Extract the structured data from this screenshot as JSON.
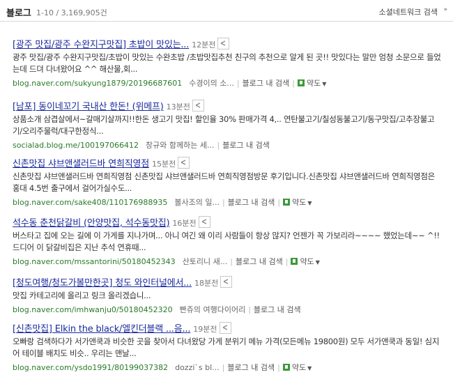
{
  "header": {
    "section_title": "블로그",
    "result_count": "1-10 / 3,169,905건",
    "social_search_label": "소셜네트워크 검색",
    "social_arrow": "»"
  },
  "icons": {
    "share": "share-icon",
    "map": "map-icon",
    "caret": "chevron-down-icon"
  },
  "common": {
    "blog_search_label": "블로그 내 검색",
    "map_label": "약도",
    "sep": "|"
  },
  "results": [
    {
      "title": "[광주 맛집/광주 수완지구맛집] 초밥이 맛있는...",
      "time": "12분전",
      "desc": "광주 맛집/광주 수완지구맛집/초밥이 맛있는 수완초밥 /초밥맛집추천 친구의 추천으로 알게 된 곳!! 맛있다는 말만 엄청 소문으로 들었는데 드뎌 다녀왔어요 ^^ 해산물,회...",
      "url": "blog.naver.com/sukyung1879/20196687601",
      "author": "수경이의 소...",
      "has_map": true
    },
    {
      "title": "[남포] 동이네꼬기 국내산 한돈! (위메프)",
      "time": "13분전",
      "desc": "상품소개 삼겹살에서~갈매기살까지!!한돈 생고기 맛집! 할인율 30% 판매가격 4,.. 연탄불고기/칠성동불고기/동구맛집/고추장불고기/오리주물럭/대구한정식...",
      "url": "socialad.blog.me/100197066412",
      "author": "창규와 함께하는 세...",
      "has_map": false
    },
    {
      "title": "신촌맛집 샤브앤샐러드바 연희직영점",
      "time": "15분전",
      "desc": "신촌맛집 샤브앤샐러드바 연희직영점 신촌맛집 샤브앤샐러드바 연희직영점방문 후기입니다.신촌맛집 샤브앤샐러드바 연희직영점은 홍대 4.5번 출구에서 걸어가실수도...",
      "url": "blog.naver.com/sake408/110176988935",
      "author": "볼사조의 일...",
      "has_map": true
    },
    {
      "title": "석수동 춘천닭갈비 (안양맛집, 석수동맛집)",
      "time": "16분전",
      "desc": "버스타고 집에 오는 길에 이 가게를 지나가며... 아니 여긴 왜 이리 사람들이 항상 많지? 언젠가 꼭 가보리라~~~~ 했었는데~~ ^!! 드디어 이 닭갈비집은 지난 추석 연휴때...",
      "url": "blog.naver.com/mssantorini/50180452343",
      "author": "산토리니 새...",
      "has_map": true
    },
    {
      "title": "[청도여행/청도가볼만한곳] 청도 와인터널에서...",
      "time": "18분전",
      "desc": "맛집 카테고리에 올리고 링크 올리겠습니...",
      "url": "blog.naver.com/imhwanju0/50180452320",
      "author": "빤쥬의 여행다이어리",
      "has_map": false
    },
    {
      "title": "[신촌맛집] Elkin the black/엘킨더블랙 ...음...",
      "time": "19분전",
      "desc": "오빠랑 검색하다가 서가앤쿡과 비슷한 곳을 찾아서 다녀왔당 가게 분위기 메뉴 가격(모든메뉴 19800원) 모두 서가앤쿡과 동일! 심지어 테이블 배치도 비슷.. 우리는 맨날...",
      "url": "blog.naver.com/ysdo1991/80199037382",
      "author": "dozzi`s bl...",
      "has_map": true
    }
  ]
}
